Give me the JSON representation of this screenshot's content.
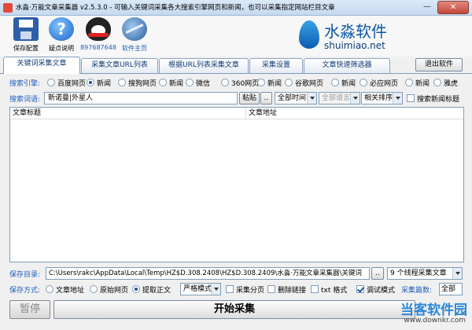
{
  "window": {
    "title": "水淼·万能文章采集器 v2.5.3.0 - 可输入关键词采集各大搜索引擎网页和新闻，也可以采集指定网站栏目文章",
    "minimize_glyph": "—",
    "close_glyph": "✕"
  },
  "toolbar": {
    "save_label": "保存配置",
    "help_label": "疑点说明",
    "qq_label": "897687648",
    "home_label": "软件主页",
    "help_glyph": "?"
  },
  "logo": {
    "name": "水淼软件",
    "domain": "shuimiao.net"
  },
  "tabs": [
    {
      "label": "关键词采集文章"
    },
    {
      "label": "采集文章URL列表"
    },
    {
      "label": "根据URL列表采集文章"
    },
    {
      "label": "采集设置"
    },
    {
      "label": "文章快速筛选器"
    }
  ],
  "exit_label": "退出软件",
  "search_engine": {
    "label": "搜索引擎:",
    "options": [
      "百度网页",
      "新闻",
      "搜狗网页",
      "新闻",
      "微信",
      "360网页",
      "新闻",
      "谷歌网页",
      "新闻",
      "必应网页",
      "新闻",
      "雅虎"
    ],
    "selected_index": 1
  },
  "keywords": {
    "label": "搜索词语:",
    "value": "新诺曼|外星人",
    "paste_label": "粘贴",
    "more_label": "..",
    "time_value": "全部时间",
    "language_value": "全部语言",
    "sort_value": "相关排序",
    "news_title_label": "搜索新闻标题"
  },
  "table": {
    "columns": [
      "文章标题",
      "文章地址"
    ]
  },
  "save_dir": {
    "label": "保存目录:",
    "value": "C:\\Users\\rakc\\AppData\\Local\\Temp\\HZ$D.308.2408\\HZ$D.308.2409\\水淼·万能文章采集器\\关键词",
    "browse_label": "..",
    "threads_value": "9 个线程采集文章"
  },
  "save_mode": {
    "label": "保存方式:",
    "options": [
      "文章地址",
      "原始网页",
      "提取正文"
    ],
    "selected_index": 2,
    "mode_value": "严格模式",
    "paged_label": "采集分页",
    "remove_links_label": "删除链接",
    "txt_label": "txt 格式",
    "debug_label": "调试模式",
    "count_label": "采集篇数:",
    "count_value": "全部"
  },
  "actions": {
    "pause_label": "暂停",
    "start_label": "开始采集"
  },
  "watermark": {
    "name": "当客软件园",
    "url": "www.downkr.com"
  }
}
